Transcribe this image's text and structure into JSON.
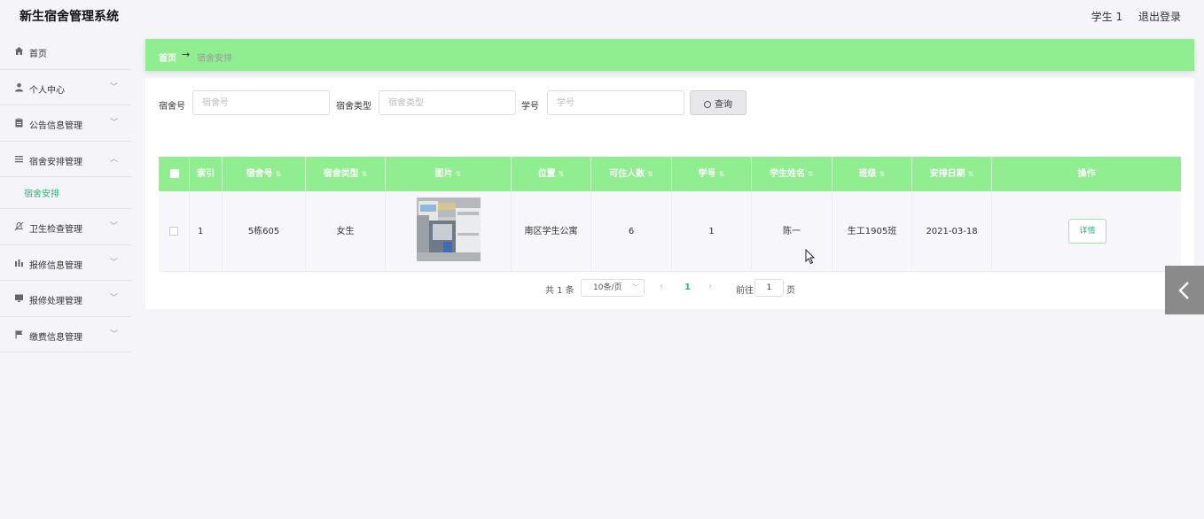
{
  "header": {
    "app_title": "新生宿舍管理系统",
    "user": "学生 1",
    "logout": "退出登录"
  },
  "sidebar": {
    "items": [
      {
        "label": "首页",
        "icon": "home-icon",
        "has_chevron": false
      },
      {
        "label": "个人中心",
        "icon": "user-icon",
        "has_chevron": true
      },
      {
        "label": "公告信息管理",
        "icon": "clipboard-icon",
        "has_chevron": true
      },
      {
        "label": "宿舍安排管理",
        "icon": "menu-lines-icon",
        "has_chevron": true,
        "expanded": true
      },
      {
        "label": "卫生检查管理",
        "icon": "bell-off-icon",
        "has_chevron": true
      },
      {
        "label": "报修信息管理",
        "icon": "bar-chart-icon",
        "has_chevron": true
      },
      {
        "label": "报修处理管理",
        "icon": "monitor-icon",
        "has_chevron": true
      },
      {
        "label": "缴费信息管理",
        "icon": "flag-icon",
        "has_chevron": true
      }
    ],
    "submenu_active": "宿舍安排"
  },
  "breadcrumb": {
    "home": "首页",
    "current": "宿舍安排"
  },
  "search": {
    "fields": [
      {
        "label": "宿舍号",
        "placeholder": "宿舍号",
        "value": ""
      },
      {
        "label": "宿舍类型",
        "placeholder": "宿舍类型",
        "value": ""
      },
      {
        "label": "学号",
        "placeholder": "学号",
        "value": ""
      }
    ],
    "button": "查询"
  },
  "table": {
    "columns": [
      "索引",
      "宿舍号",
      "宿舍类型",
      "图片",
      "位置",
      "可住人数",
      "学号",
      "学生姓名",
      "班级",
      "安排日期",
      "操作"
    ],
    "rows": [
      {
        "index": "1",
        "dorm_no": "5栋605",
        "dorm_type": "女生",
        "image": "dorm-room-photo",
        "location": "南区学生公寓",
        "capacity": "6",
        "student_id": "1",
        "student_name": "陈一",
        "class": "生工1905班",
        "date": "2021-03-18",
        "action": "详情"
      }
    ]
  },
  "pagination": {
    "total": "共 1 条",
    "page_size": "10条/页",
    "current_page": "1",
    "goto_label": "前往",
    "goto_value": "1",
    "page_unit": "页"
  },
  "colors": {
    "accent_green": "#90ee90",
    "link_green": "#2bb673",
    "background": "#f4f4f9"
  }
}
